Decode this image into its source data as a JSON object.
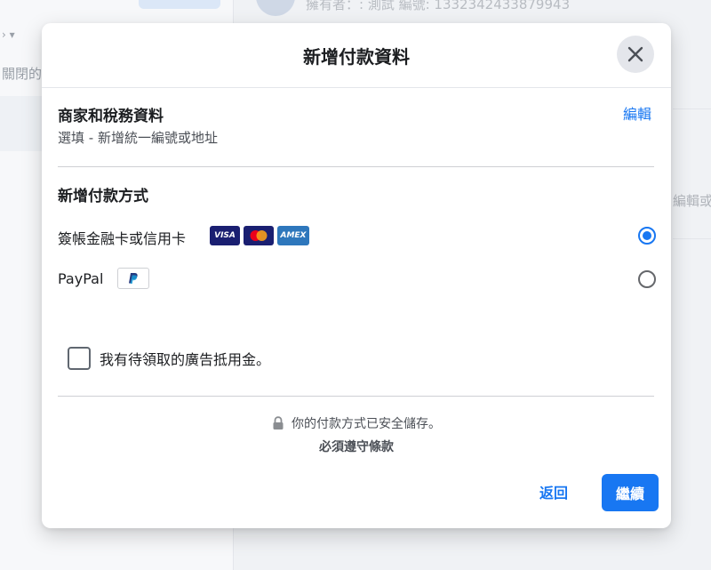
{
  "background": {
    "top_text": "擁有者：: 測試  編號: 1332342433879943",
    "left_text": "關閉的",
    "left_caret": "›    ▾",
    "right_text": "編輯或"
  },
  "modal": {
    "title": "新增付款資料",
    "business": {
      "title": "商家和稅務資料",
      "subtitle": "選填 - 新增統一編號或地址",
      "edit_label": "編輯"
    },
    "payment": {
      "title": "新增付款方式",
      "options": [
        {
          "label": "簽帳金融卡或信用卡",
          "selected": true
        },
        {
          "label": "PayPal",
          "selected": false
        }
      ],
      "card_logos": [
        "VISA",
        "mastercard",
        "AMEX"
      ]
    },
    "ad_credit_label": "我有待領取的廣告抵用金。",
    "secure_text": "你的付款方式已安全儲存。",
    "terms_text": "必須遵守條款",
    "back_label": "返回",
    "continue_label": "繼續"
  },
  "colors": {
    "accent": "#1877f2",
    "visa": "#1a1f71",
    "amex": "#2e77bc"
  },
  "icons": {
    "close": "close-icon",
    "lock": "lock-icon",
    "paypal": "paypal-icon"
  }
}
